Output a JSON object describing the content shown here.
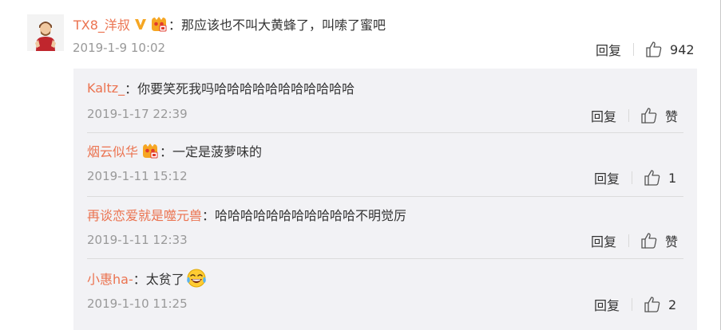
{
  "main_comment": {
    "username": "TX8_洋叔",
    "text": "那应该也不叫大黄蜂了，叫嗦了蜜吧",
    "time": "2019-1-9 10:02",
    "reply_label": "回复",
    "like_count": "942",
    "icons": [
      "verified-v-icon",
      "member-badge-icon",
      "thumbs-up-icon"
    ]
  },
  "colon": "：",
  "replies": [
    {
      "username": "Kaltz_",
      "text": "你要笑死我吗哈哈哈哈哈哈哈哈哈哈哈",
      "time": "2019-1-17 22:39",
      "reply_label": "回复",
      "like_label": "赞"
    },
    {
      "username": "烟云似华",
      "text": "一定是菠萝味的",
      "time": "2019-1-11 15:12",
      "reply_label": "回复",
      "like_label": "1"
    },
    {
      "username": "再谈恋爱就是噬元兽",
      "text": "哈哈哈哈哈哈哈哈哈哈哈不明觉厉",
      "time": "2019-1-11 12:33",
      "reply_label": "回复",
      "like_label": "赞"
    },
    {
      "username": "小惠ha-",
      "text": "太贫了",
      "time": "2019-1-10 11:25",
      "reply_label": "回复",
      "like_label": "2"
    }
  ],
  "colors": {
    "username": "#eb7350",
    "text": "#333333",
    "time": "#999999",
    "reply_panel_bg": "#f2f2f5"
  }
}
